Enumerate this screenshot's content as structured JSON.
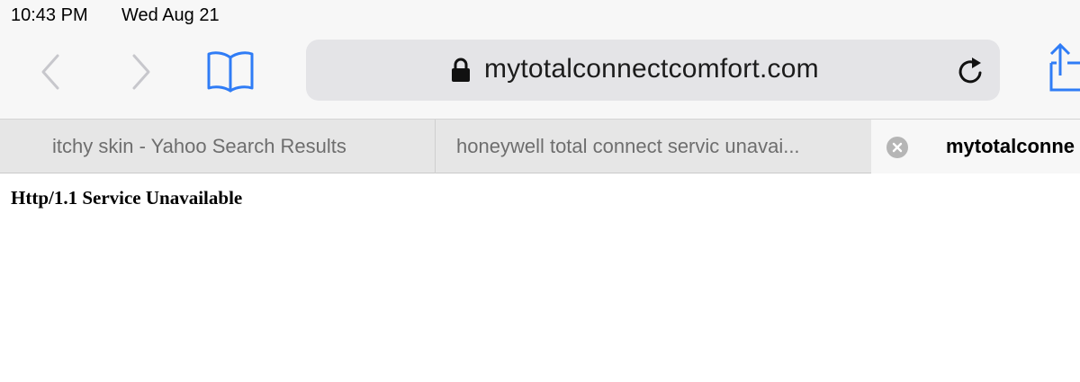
{
  "status_bar": {
    "time": "10:43 PM",
    "date": "Wed Aug 21"
  },
  "toolbar": {
    "back_icon": "chevron-left-icon",
    "forward_icon": "chevron-right-icon",
    "bookmarks_icon": "open-book-icon",
    "share_icon": "share-icon",
    "accent_color": "#2f7cf6",
    "disabled_color": "#c7c7cc"
  },
  "address_bar": {
    "secure_icon": "lock-icon",
    "url": "mytotalconnectcomfort.com",
    "reload_icon": "reload-icon"
  },
  "tabs": [
    {
      "label": "itchy skin - Yahoo Search Results",
      "active": false
    },
    {
      "label": "honeywell total connect servic unavai...",
      "active": false
    },
    {
      "label": "mytotalconne",
      "active": true,
      "close_icon": "close-icon"
    }
  ],
  "page": {
    "heading": "Http/1.1 Service Unavailable"
  }
}
